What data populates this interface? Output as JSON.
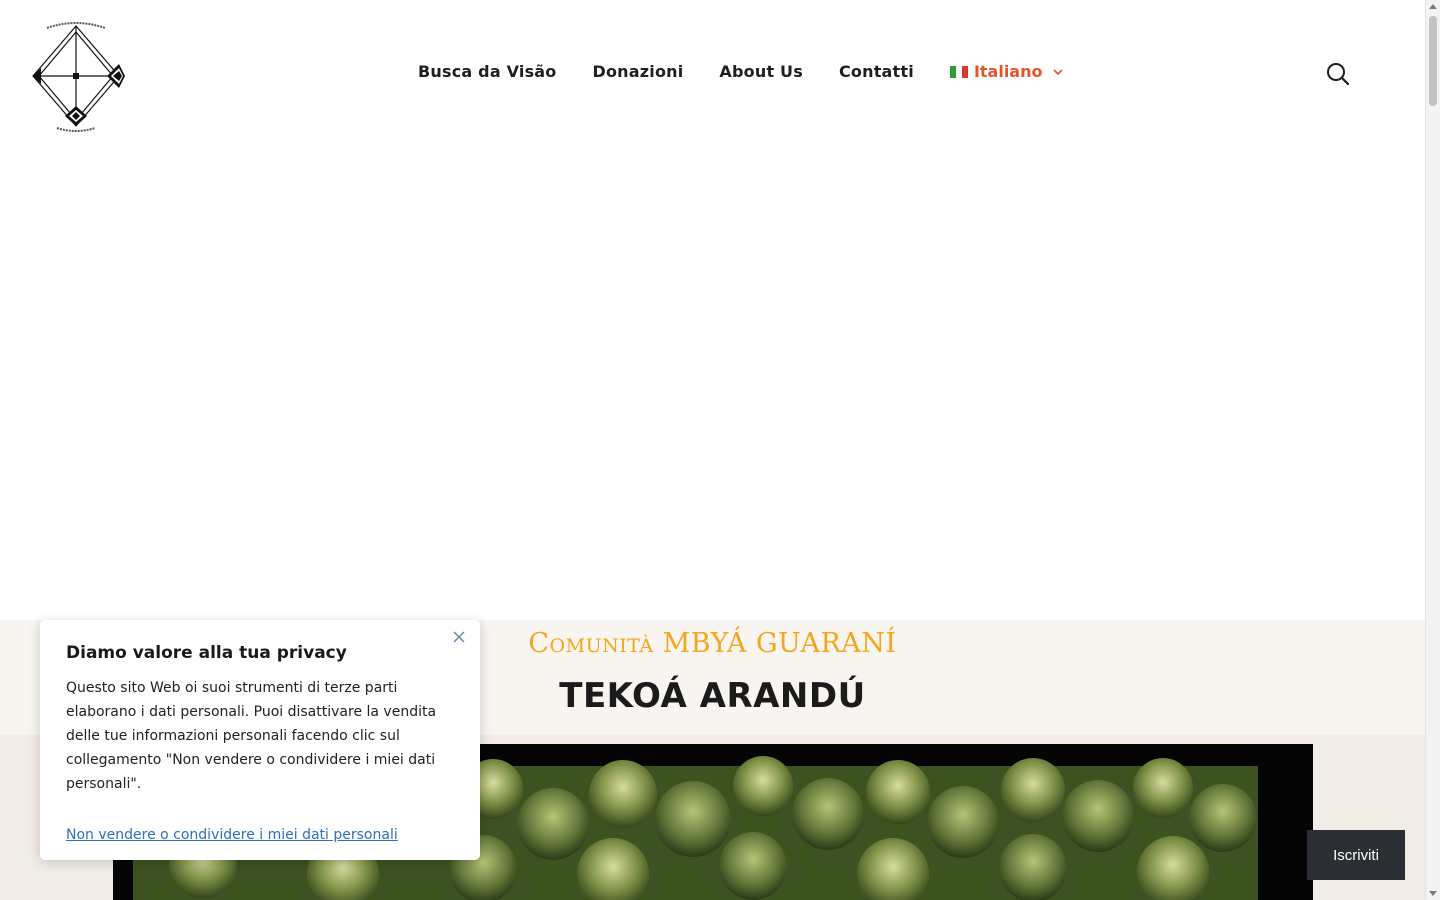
{
  "header": {
    "logo_name": "logo-icon",
    "nav": [
      "Busca da Visão",
      "Donazioni",
      "About Us",
      "Contatti"
    ],
    "language": {
      "label": "Italiano",
      "flag_colors": [
        "#2e9a3a",
        "#ffffff",
        "#d83a31"
      ],
      "accent": "#e8542a"
    },
    "search_icon": "search-icon"
  },
  "hero": {
    "subtitle": "Comunità MBYÁ GUARANÍ",
    "subtitle_color": "#f3a51c",
    "title": "TEKOÁ ARANDÚ"
  },
  "privacy_popup": {
    "title": "Diamo valore alla tua privacy",
    "body": "Questo sito Web oi suoi strumenti di terze parti elaborano i dati personali. Puoi disattivare la vendita delle tue informazioni personali facendo clic sul collegamento \"Non vendere o condividere i miei dati personali\".",
    "link": "Non vendere o condividere i miei dati personali",
    "link_color": "#2f6fbf",
    "close_icon": "close-icon"
  },
  "subscribe": {
    "label": "Iscriviti",
    "background": "#2b2f33"
  }
}
